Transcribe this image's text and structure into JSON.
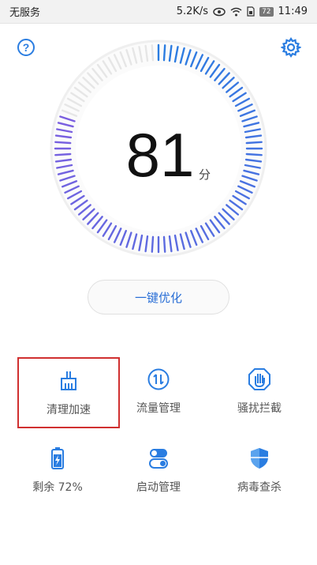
{
  "status_bar": {
    "carrier": "无服务",
    "speed": "5.2K/s",
    "battery": "72",
    "time": "11:49"
  },
  "header": {
    "help_icon": "question-circle-icon",
    "settings_icon": "gear-icon"
  },
  "score": {
    "value": "81",
    "unit": "分",
    "level": 0.81
  },
  "optimize_button": {
    "label": "一键优化"
  },
  "tools": [
    {
      "label": "清理加速",
      "icon": "broom-icon",
      "selected": true
    },
    {
      "label": "流量管理",
      "icon": "data-traffic-icon"
    },
    {
      "label": "骚扰拦截",
      "icon": "hand-shield-icon"
    },
    {
      "label": "剩余 72%",
      "icon": "battery-icon"
    },
    {
      "label": "启动管理",
      "icon": "toggle-switch-icon"
    },
    {
      "label": "病毒查杀",
      "icon": "virus-shield-icon"
    }
  ],
  "colors": {
    "accent": "#2a6fd6",
    "tick_start": "#2a7de1",
    "tick_end": "#7b5fe0",
    "tick_inactive": "#e6e6e6",
    "highlight": "#d03030"
  }
}
